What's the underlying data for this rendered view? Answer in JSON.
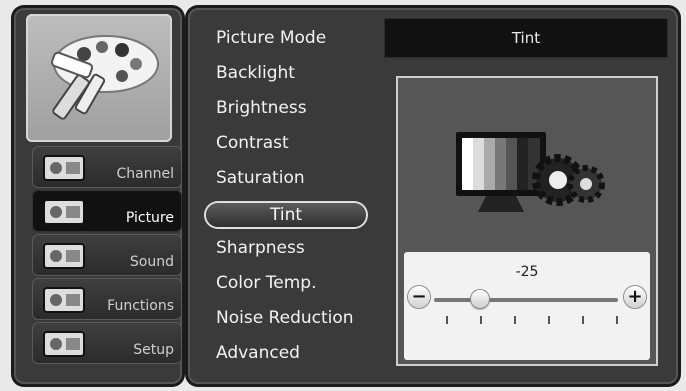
{
  "categories": [
    {
      "label": "Channel",
      "icon": "tv-icon"
    },
    {
      "label": "Picture",
      "icon": "palette-icon"
    },
    {
      "label": "Sound",
      "icon": "speaker-icon"
    },
    {
      "label": "Functions",
      "icon": "toolbox-icon"
    },
    {
      "label": "Setup",
      "icon": "gears-icon"
    }
  ],
  "active_category": "Picture",
  "menu": {
    "items": [
      "Picture Mode",
      "Backlight",
      "Brightness",
      "Contrast",
      "Saturation",
      "Tint",
      "Sharpness",
      "Color Temp.",
      "Noise Reduction",
      "Advanced"
    ],
    "selected": "Tint"
  },
  "detail": {
    "title": "Tint",
    "slider": {
      "value": -25,
      "min": -50,
      "max": 50,
      "minus_symbol": "−",
      "plus_symbol": "+"
    }
  }
}
